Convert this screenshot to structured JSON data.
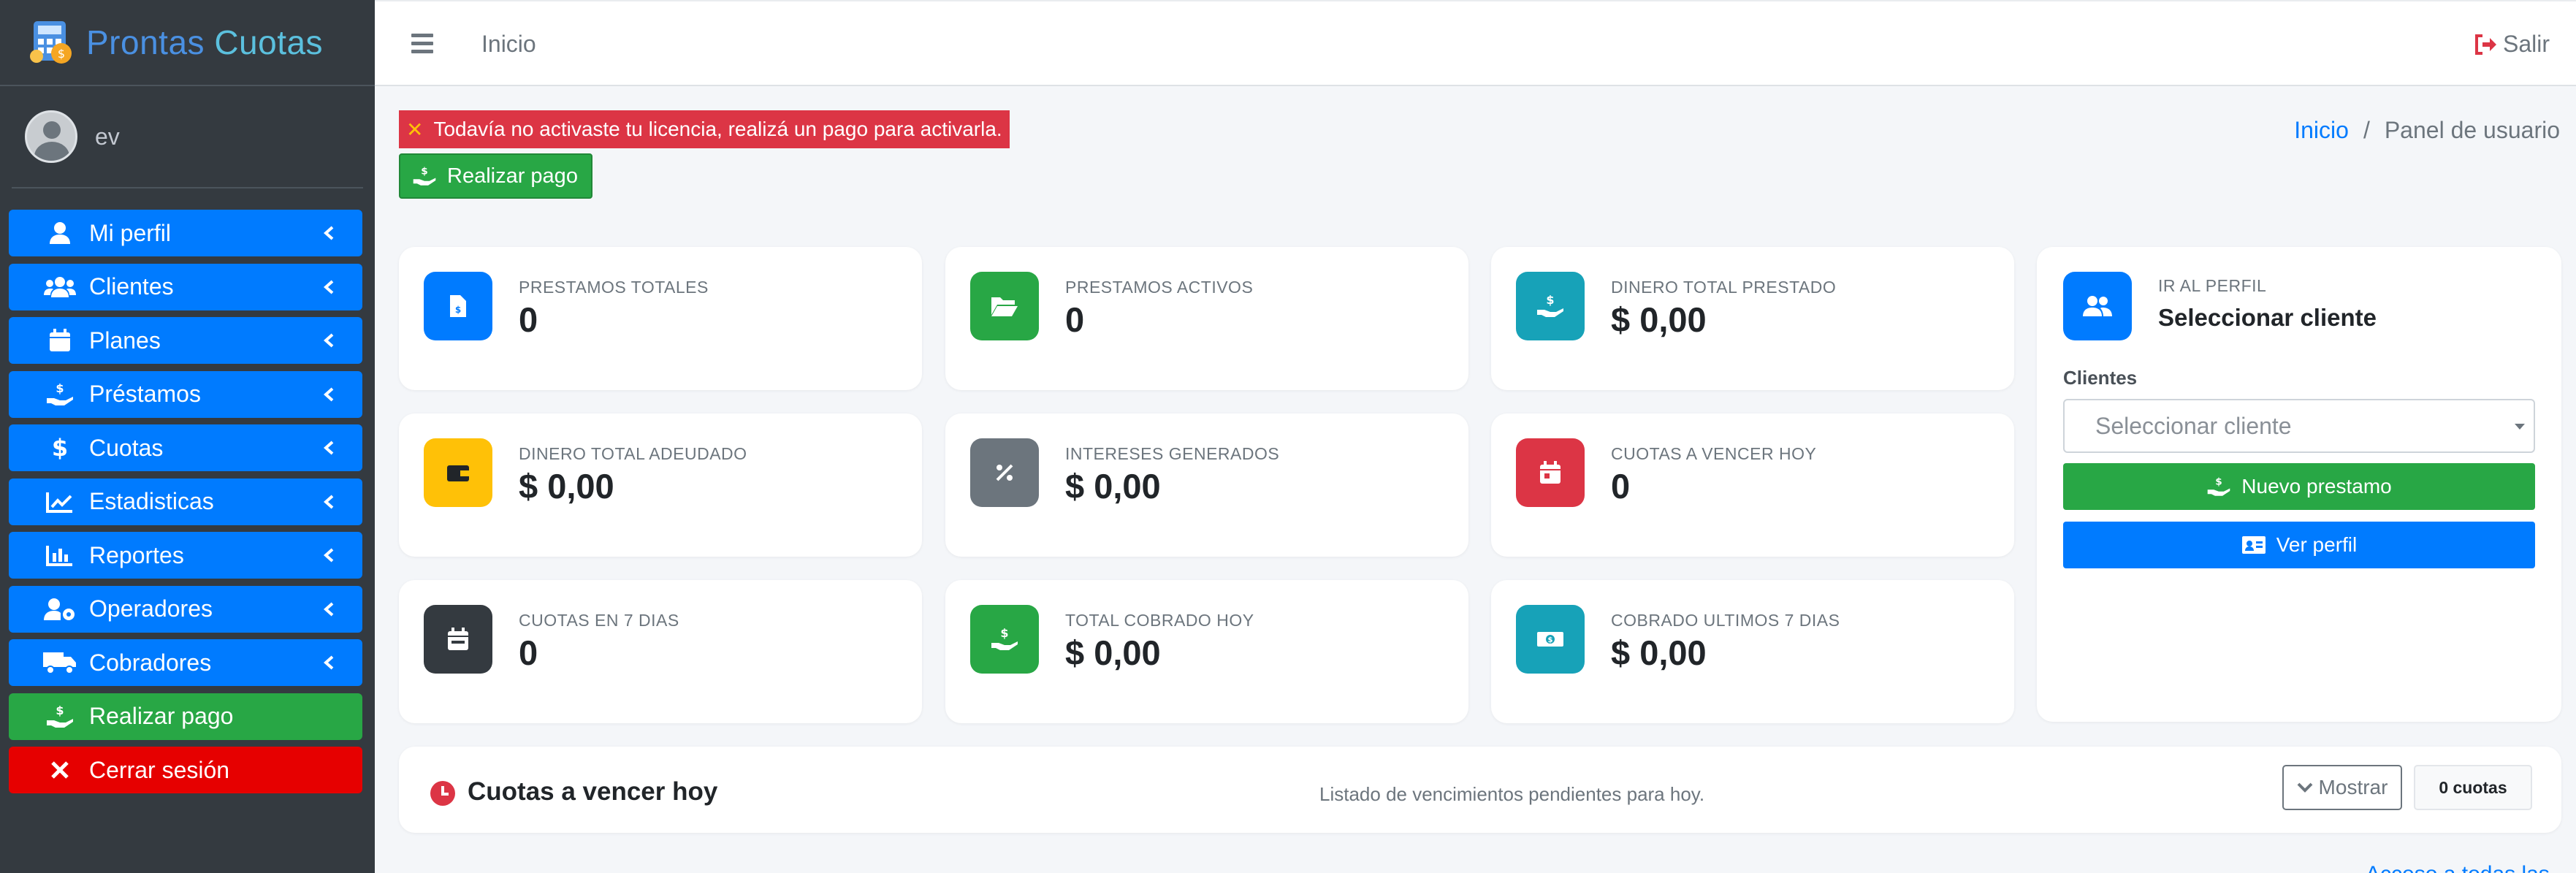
{
  "brand": {
    "name_part1": "Prontas",
    "name_part2": "Cuotas"
  },
  "user": {
    "name": "ev"
  },
  "sidebar": {
    "items": [
      {
        "label": "Mi perfil",
        "icon": "user-icon"
      },
      {
        "label": "Clientes",
        "icon": "users-icon"
      },
      {
        "label": "Planes",
        "icon": "calendar-icon"
      },
      {
        "label": "Préstamos",
        "icon": "hand-money-icon"
      },
      {
        "label": "Cuotas",
        "icon": "dollar-icon"
      },
      {
        "label": "Estadisticas",
        "icon": "chart-line-icon"
      },
      {
        "label": "Reportes",
        "icon": "chart-bar-icon"
      },
      {
        "label": "Operadores",
        "icon": "user-cog-icon"
      },
      {
        "label": "Cobradores",
        "icon": "truck-icon"
      },
      {
        "label": "Realizar pago",
        "icon": "hand-money-icon"
      },
      {
        "label": "Cerrar sesión",
        "icon": "close-icon"
      }
    ]
  },
  "topbar": {
    "home": "Inicio",
    "logout": "Salir"
  },
  "alert": {
    "message": "Todavía no activaste tu licencia, realizá un pago para activarla."
  },
  "pay_button": {
    "label": "Realizar pago"
  },
  "breadcrumb": {
    "home": "Inicio",
    "separator": "/",
    "current": "Panel de usuario"
  },
  "stats": [
    {
      "title": "PRESTAMOS TOTALES",
      "value": "0",
      "color": "#007bff",
      "icon": "file-icon"
    },
    {
      "title": "PRESTAMOS ACTIVOS",
      "value": "0",
      "color": "#28a745",
      "icon": "folder-open-icon"
    },
    {
      "title": "DINERO TOTAL PRESTADO",
      "value": "$ 0,00",
      "color": "#17a2b8",
      "icon": "hand-money-icon"
    },
    {
      "title": "DINERO TOTAL ADEUDADO",
      "value": "$ 0,00",
      "color": "#ffc107",
      "icon": "wallet-icon"
    },
    {
      "title": "INTERESES GENERADOS",
      "value": "$ 0,00",
      "color": "#6c757d",
      "icon": "percent-icon"
    },
    {
      "title": "CUOTAS A VENCER HOY",
      "value": "0",
      "color": "#dc3545",
      "icon": "calendar-day-icon"
    },
    {
      "title": "CUOTAS EN 7 DIAS",
      "value": "0",
      "color": "#343a40",
      "icon": "calendar-week-icon"
    },
    {
      "title": "TOTAL COBRADO HOY",
      "value": "$ 0,00",
      "color": "#28a745",
      "icon": "hand-money-icon"
    },
    {
      "title": "COBRADO ULTIMOS 7 DIAS",
      "value": "$ 0,00",
      "color": "#17a2b8",
      "icon": "money-bill-icon"
    }
  ],
  "profile_card": {
    "title": "IR AL PERFIL",
    "subtitle": "Seleccionar cliente",
    "clients_label": "Clientes",
    "select_placeholder": "Seleccionar cliente",
    "new_loan_label": "Nuevo prestamo",
    "view_profile_label": "Ver perfil"
  },
  "due_today": {
    "title": "Cuotas a vencer hoy",
    "description": "Listado de vencimientos pendientes para hoy.",
    "show_label": "Mostrar",
    "count_label": "0 cuotas"
  },
  "bottom_link": {
    "label": "Acceso a todas las cuotas"
  }
}
